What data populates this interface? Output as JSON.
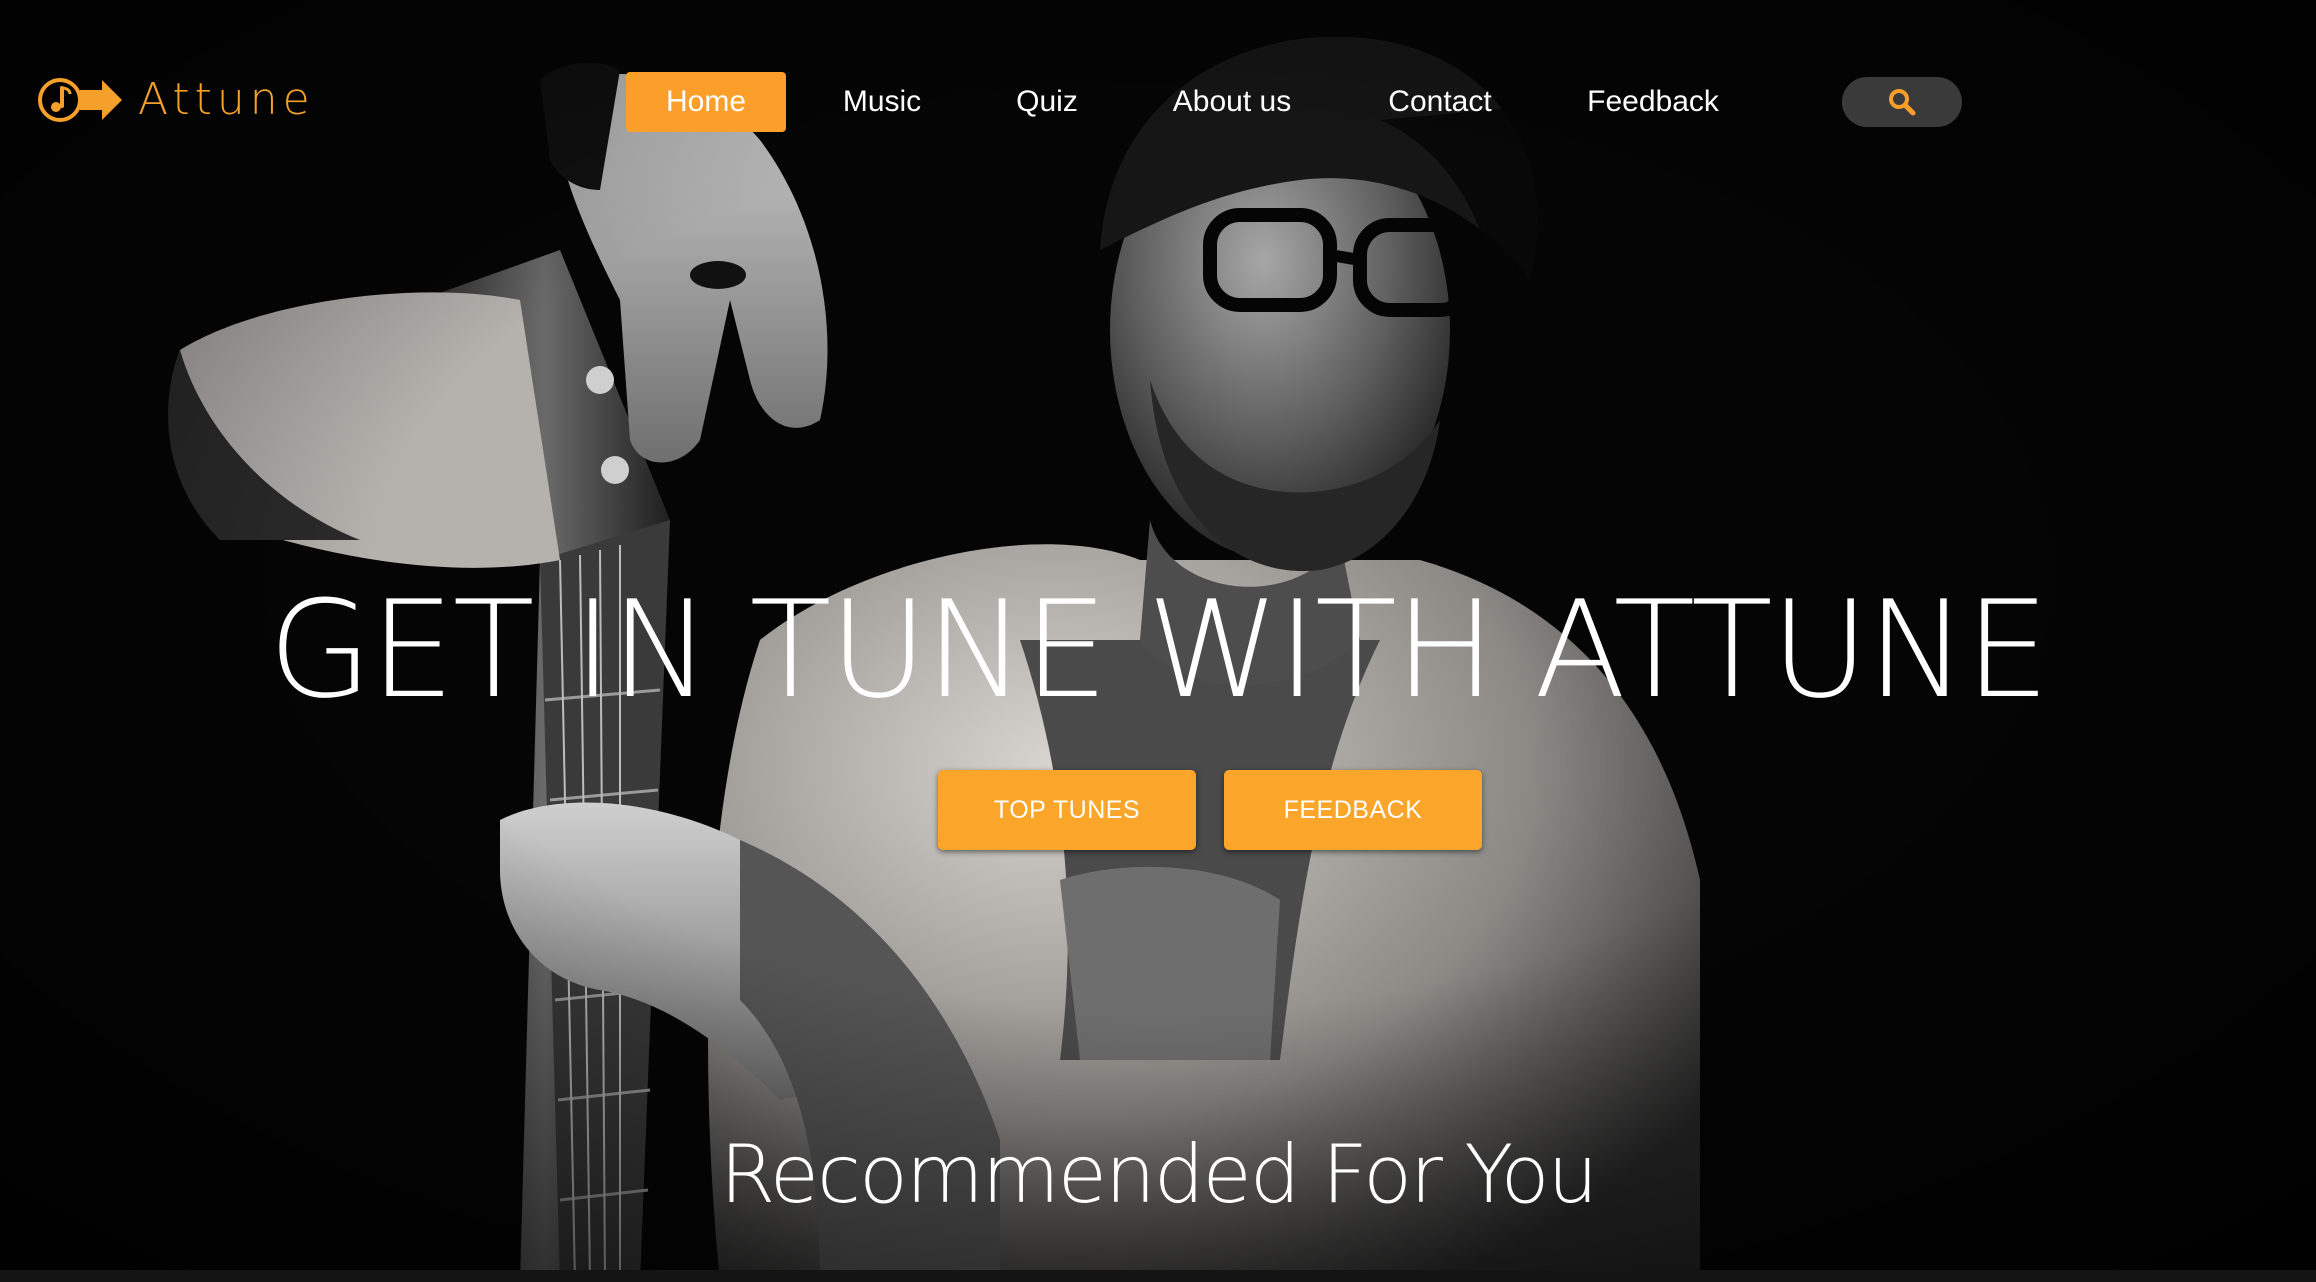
{
  "brand": {
    "name": "Attune",
    "accent_color": "#fb9f2a",
    "logo_icon": "music-note-arrow-icon"
  },
  "nav": {
    "items": [
      {
        "label": "Home",
        "active": true
      },
      {
        "label": "Music",
        "active": false
      },
      {
        "label": "Quiz",
        "active": false
      },
      {
        "label": "About us",
        "active": false
      },
      {
        "label": "Contact",
        "active": false
      },
      {
        "label": "Feedback",
        "active": false
      }
    ],
    "search_icon": "search-icon"
  },
  "hero": {
    "headline": "GET IN TUNE WITH ATTUNE",
    "buttons": {
      "top_tunes": "TOP TUNES",
      "feedback": "FEEDBACK"
    },
    "background_image": "black-and-white photo of man with glasses holding acoustic guitar headstock"
  },
  "recommended": {
    "title": "Recommended For You"
  }
}
